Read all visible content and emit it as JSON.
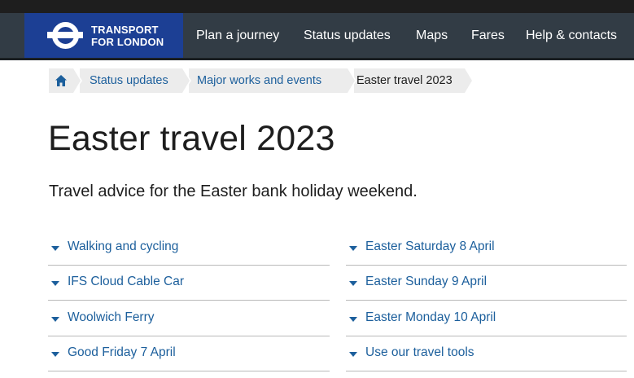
{
  "header": {
    "logo_line1": "TRANSPORT",
    "logo_line2": "FOR LONDON",
    "nav": [
      {
        "label": "Plan a journey"
      },
      {
        "label": "Status updates"
      },
      {
        "label": "Maps"
      },
      {
        "label": "Fares"
      },
      {
        "label": "Help & contacts"
      }
    ]
  },
  "breadcrumb": {
    "home_icon": "home-icon",
    "items": [
      {
        "label": "Status updates"
      },
      {
        "label": "Major works and events"
      },
      {
        "label": "Easter travel 2023"
      }
    ]
  },
  "main": {
    "title": "Easter travel 2023",
    "intro": "Travel advice for the Easter bank holiday weekend.",
    "left_column": [
      {
        "label": "Walking and cycling"
      },
      {
        "label": "IFS Cloud Cable Car"
      },
      {
        "label": "Woolwich Ferry"
      },
      {
        "label": "Good Friday 7 April"
      }
    ],
    "right_column": [
      {
        "label": "Easter Saturday 8 April"
      },
      {
        "label": "Easter Sunday 9 April"
      },
      {
        "label": "Easter Monday 10 April"
      },
      {
        "label": "Use our travel tools"
      }
    ]
  },
  "colors": {
    "brand_blue": "#1c3f94",
    "nav_bg": "#323c45",
    "link": "#1c5f9c"
  }
}
